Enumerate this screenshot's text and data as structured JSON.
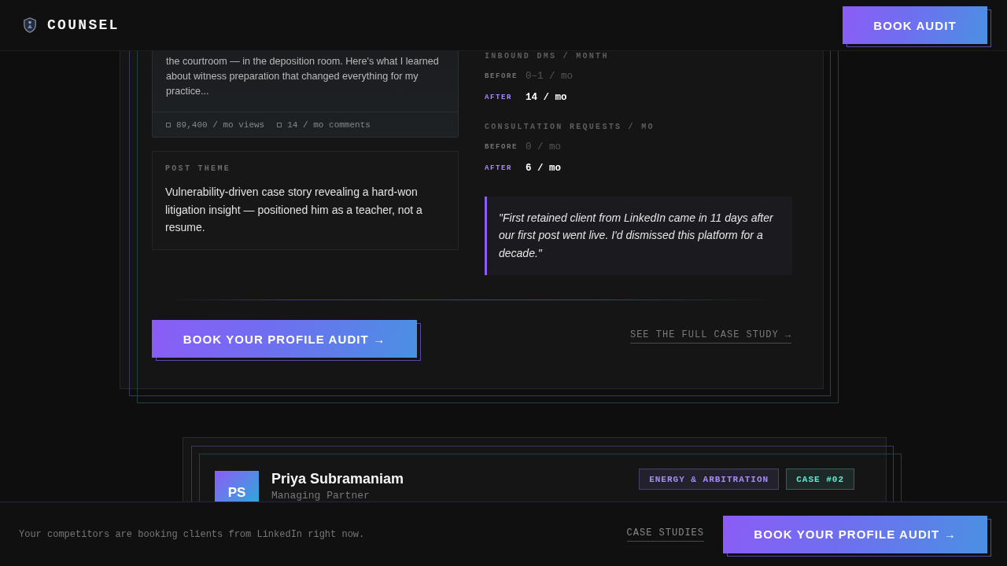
{
  "header": {
    "brand": "COUNSEL",
    "button": "BOOK AUDIT"
  },
  "cases": [
    {
      "kind": "details",
      "post": {
        "excerpt": "the courtroom — in the deposition room. Here's what I learned about witness preparation that changed everything for my practice...",
        "stats": [
          "89,400 / mo views",
          "14 / mo comments"
        ]
      },
      "post_theme": {
        "label": "POST THEME",
        "text": "Vulnerability-driven case story revealing a hard-won litigation insight — positioned him as a teacher, not a resume."
      },
      "metrics": [
        {
          "title": "INBOUND DMS / MONTH",
          "rows": [
            {
              "kind": "before",
              "label": "BEFORE",
              "value": "0–1 / mo"
            },
            {
              "kind": "after",
              "label": "AFTER",
              "value": "14 / mo"
            }
          ]
        },
        {
          "title": "CONSULTATION REQUESTS / MO",
          "rows": [
            {
              "kind": "before",
              "label": "BEFORE",
              "value": "0 / mo"
            },
            {
              "kind": "after",
              "label": "AFTER",
              "value": "6 / mo"
            }
          ]
        }
      ],
      "quote": "\"First retained client from LinkedIn came in 11 days after our first post went live. I'd dismissed this platform for a decade.\"",
      "cta_button": "BOOK YOUR PROFILE AUDIT →",
      "link": "SEE THE FULL CASE STUDY →"
    },
    {
      "kind": "header",
      "avatar": "PS",
      "name": "Priya Subramaniam",
      "role": "Managing Partner",
      "tags": [
        {
          "text": "ENERGY & ARBITRATION",
          "color": "#a78bfa"
        },
        {
          "text": "CASE #02",
          "color": "#5eead4"
        }
      ]
    }
  ],
  "bottom_bar": {
    "message": "Your competitors are booking clients from LinkedIn right now.",
    "link": "CASE STUDIES",
    "button": "BOOK YOUR PROFILE AUDIT →"
  }
}
